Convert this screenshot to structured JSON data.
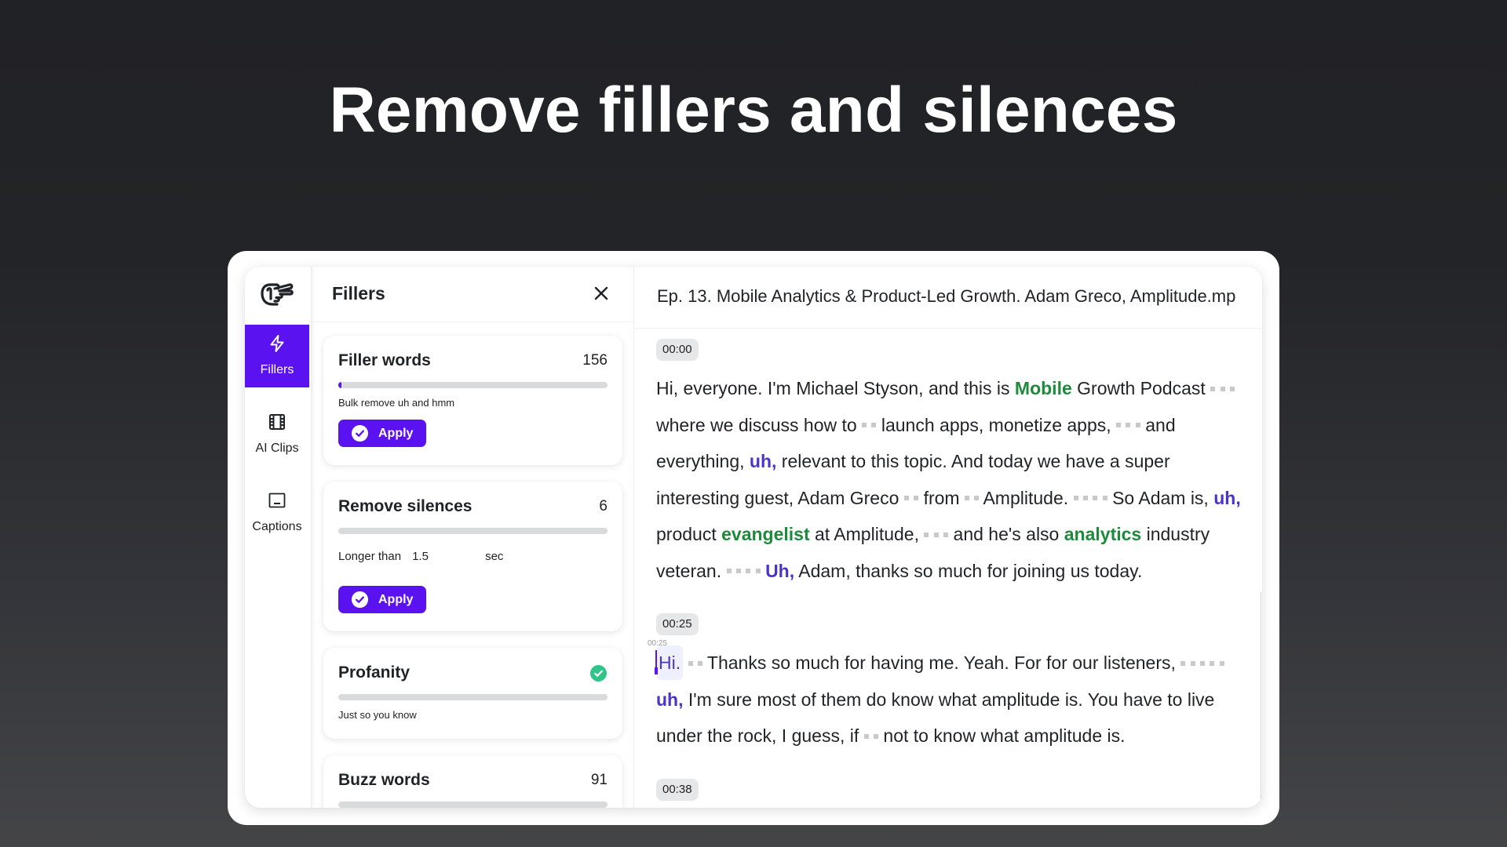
{
  "page": {
    "headline": "Remove fillers and silences"
  },
  "sidebar": {
    "logo_icon": "hand-logo-icon",
    "items": [
      {
        "label": "Fillers",
        "icon": "lightning-icon",
        "active": true
      },
      {
        "label": "AI Clips",
        "icon": "film-icon",
        "active": false
      },
      {
        "label": "Captions",
        "icon": "captions-icon",
        "active": false
      }
    ]
  },
  "fillers_panel": {
    "title": "Fillers",
    "close_icon": "close-icon",
    "cards": [
      {
        "title": "Filler words",
        "count": "156",
        "progress": 0.01,
        "description": "Bulk remove uh and hmm",
        "button": "Apply"
      },
      {
        "title": "Remove silences",
        "count": "6",
        "progress": 0,
        "threshold_label": "Longer than",
        "threshold_value": "1.5",
        "threshold_unit": "sec",
        "button": "Apply"
      },
      {
        "title": "Profanity",
        "status": "done",
        "status_icon": "check-circle-icon",
        "progress": 0,
        "description": "Just so you know"
      },
      {
        "title": "Buzz words",
        "count": "91",
        "progress": 0
      }
    ]
  },
  "transcript": {
    "file_title": "Ep. 13. Mobile Analytics & Product-Led Growth. Adam Greco, Amplitude.mp",
    "segments": [
      {
        "time": "00:00",
        "tokens": [
          {
            "type": "word",
            "text": "Hi, everyone. I'm Michael Styson, and this is"
          },
          {
            "type": "keyword",
            "text": "Mobile"
          },
          {
            "type": "word",
            "text": "Growth Podcast"
          },
          {
            "type": "silence",
            "dots": 3
          },
          {
            "type": "word",
            "text": "where we discuss how to"
          },
          {
            "type": "silence",
            "dots": 2
          },
          {
            "type": "word",
            "text": "launch apps, monetize apps,"
          },
          {
            "type": "silence",
            "dots": 3
          },
          {
            "type": "word",
            "text": "and everything,"
          },
          {
            "type": "filler",
            "text": "uh,"
          },
          {
            "type": "word",
            "text": "relevant to this topic. And today we have a super interesting guest, Adam Greco"
          },
          {
            "type": "silence",
            "dots": 2
          },
          {
            "type": "word",
            "text": "from"
          },
          {
            "type": "silence",
            "dots": 2
          },
          {
            "type": "word",
            "text": "Amplitude."
          },
          {
            "type": "silence",
            "dots": 4
          },
          {
            "type": "word",
            "text": "So Adam is,"
          },
          {
            "type": "filler",
            "text": "uh,"
          },
          {
            "type": "word",
            "text": "product"
          },
          {
            "type": "keyword",
            "text": "evangelist"
          },
          {
            "type": "word",
            "text": "at Amplitude,"
          },
          {
            "type": "silence",
            "dots": 3
          },
          {
            "type": "word",
            "text": "and he's also"
          },
          {
            "type": "keyword",
            "text": "analytics"
          },
          {
            "type": "word",
            "text": "industry veteran."
          },
          {
            "type": "silence",
            "dots": 4
          },
          {
            "type": "filler",
            "text": "Uh,"
          },
          {
            "type": "word",
            "text": "Adam, thanks so much for joining us today."
          }
        ]
      },
      {
        "time": "00:25",
        "cursor_time": "00:25",
        "tokens": [
          {
            "type": "current",
            "text": "Hi."
          },
          {
            "type": "silence",
            "dots": 2
          },
          {
            "type": "word",
            "text": "Thanks so much for having me. Yeah. For for our listeners,"
          },
          {
            "type": "silence",
            "dots": 5
          },
          {
            "type": "filler",
            "text": "uh,"
          },
          {
            "type": "word",
            "text": "I'm sure most of them do know what amplitude is. You have to live under the rock, I guess, if"
          },
          {
            "type": "silence",
            "dots": 2
          },
          {
            "type": "word",
            "text": "not to know what amplitude is."
          }
        ]
      },
      {
        "time": "00:38",
        "tokens": []
      }
    ]
  },
  "colors": {
    "accent": "#5a12f0",
    "filler_word": "#4b34c8",
    "keyword": "#1e8a3c",
    "silence_marker": "#c9c9c9",
    "success": "#2fc48a",
    "background_top": "#212225",
    "background_bottom": "#444547"
  }
}
